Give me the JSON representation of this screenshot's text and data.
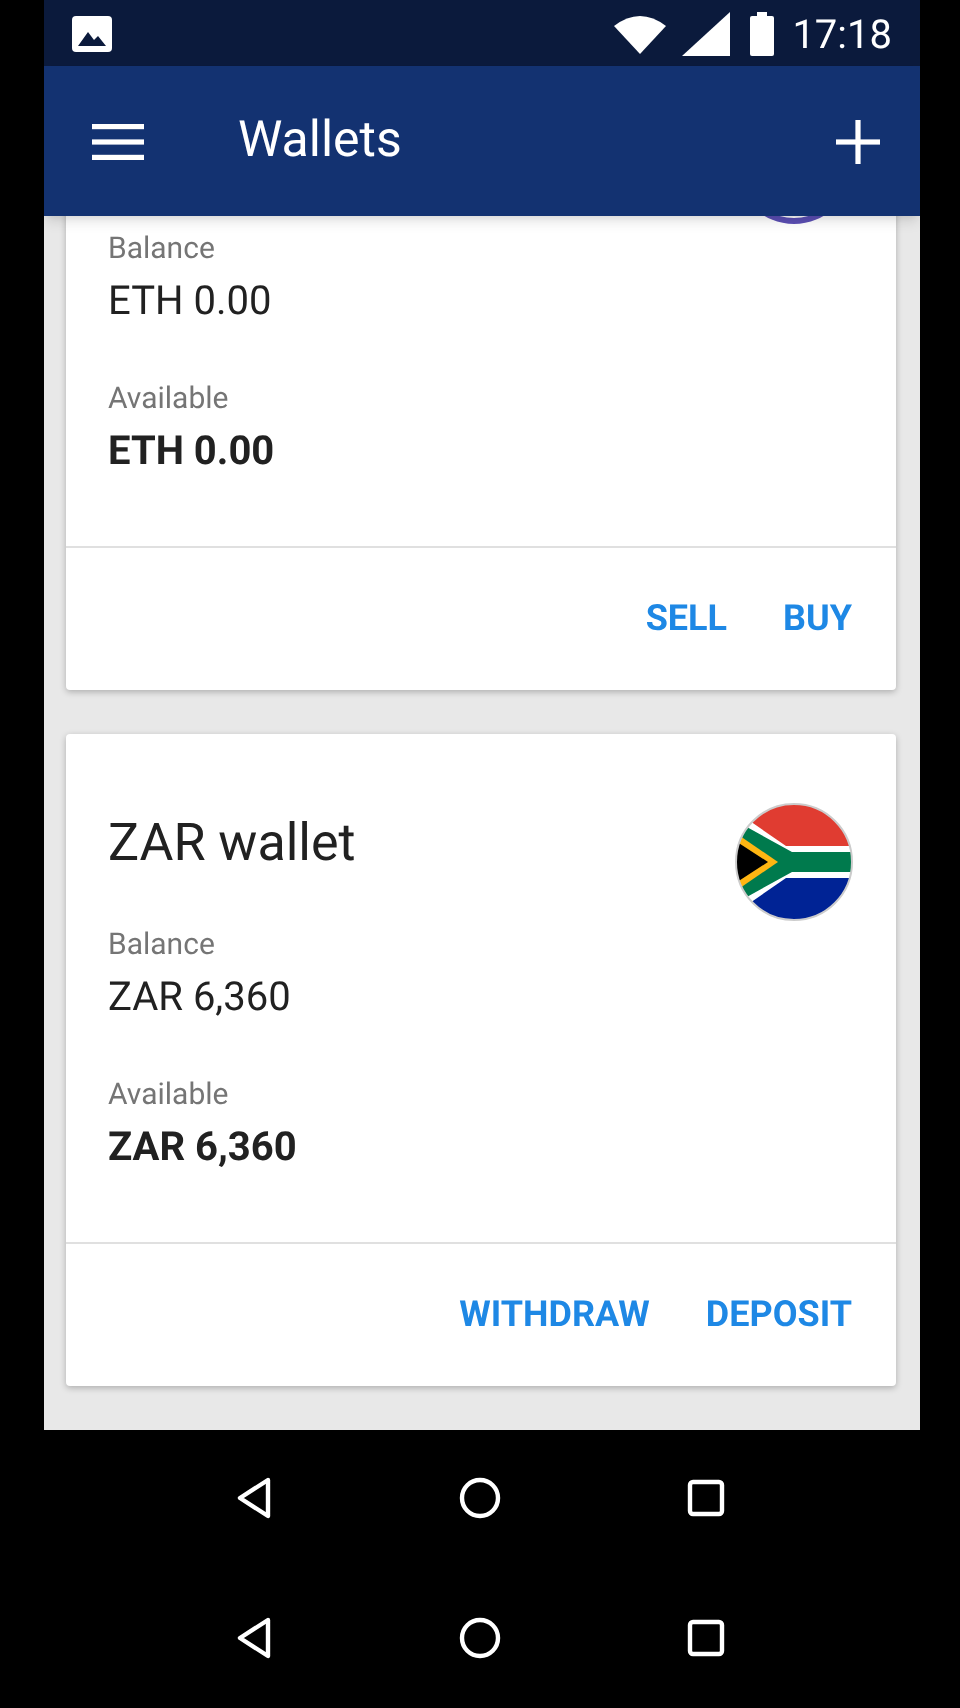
{
  "status_bar": {
    "time": "17:18"
  },
  "app_bar": {
    "title": "Wallets"
  },
  "wallets": [
    {
      "kind": "crypto",
      "balance_label": "Balance",
      "balance": "ETH 0.00",
      "available_label": "Available",
      "available": "ETH 0.00",
      "actions": [
        "SELL",
        "BUY"
      ]
    },
    {
      "kind": "fiat",
      "title": "ZAR wallet",
      "balance_label": "Balance",
      "balance": "ZAR 6,360",
      "available_label": "Available",
      "available": "ZAR 6,360",
      "actions": [
        "WITHDRAW",
        "DEPOSIT"
      ]
    }
  ]
}
